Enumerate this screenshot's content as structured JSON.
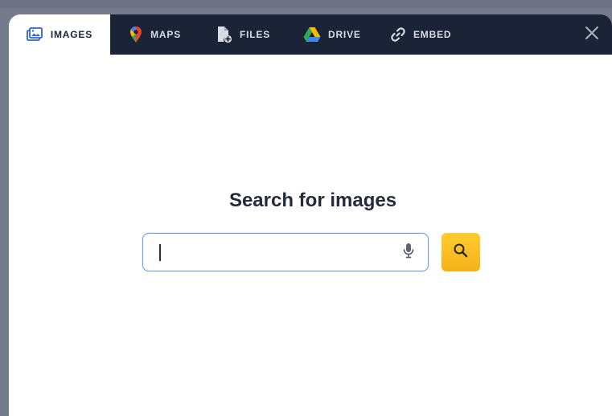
{
  "tabs": [
    {
      "id": "images",
      "label": "IMAGES",
      "icon": "images-icon",
      "active": true
    },
    {
      "id": "maps",
      "label": "MAPS",
      "icon": "map-pin-icon",
      "active": false
    },
    {
      "id": "files",
      "label": "FILES",
      "icon": "add-file-icon",
      "active": false
    },
    {
      "id": "drive",
      "label": "DRIVE",
      "icon": "drive-icon",
      "active": false
    },
    {
      "id": "embed",
      "label": "EMBED",
      "icon": "link-icon",
      "active": false
    }
  ],
  "close_icon": "close-icon",
  "search": {
    "title": "Search for images",
    "value": "",
    "placeholder": "",
    "mic_icon": "microphone-icon",
    "search_icon": "search-icon"
  },
  "colors": {
    "tabbar": "#1b2336",
    "active_tab": "#ffffff",
    "accent_button": "#f7b91f",
    "input_border": "#6d9be0",
    "backdrop": "#767b8c"
  }
}
